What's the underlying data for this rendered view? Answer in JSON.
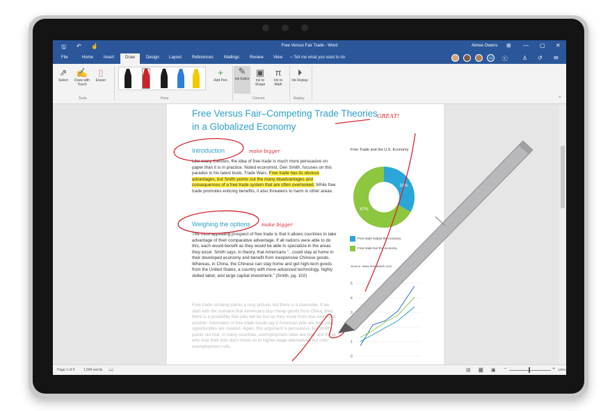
{
  "window": {
    "title": "Free Versus Fair Trade - Word",
    "user": "Aimee Owens",
    "qat_save": "🖫",
    "qat_undo": "↶",
    "qat_touch": "☝",
    "min": "—",
    "max": "▢",
    "close": "✕",
    "ribbon_display": "⊞"
  },
  "tabs": [
    "File",
    "Home",
    "Insert",
    "Draw",
    "Design",
    "Layout",
    "References",
    "Mailings",
    "Review",
    "View"
  ],
  "tell_me": "Tell me what you want to do",
  "collab_count": "+3",
  "ribbon": {
    "select": "Select",
    "draw_touch": "Draw with Touch",
    "eraser": "Eraser",
    "tools_group": "Tools",
    "pens_group": "Pens",
    "add_pen": "Add Pen",
    "ink_editor": "Ink Editor",
    "ink_to_shape": "Ink to Shape",
    "ink_to_math": "Ink to Math",
    "convert_group": "Convert",
    "ink_replay": "Ink Replay",
    "replay_group": "Replay",
    "pen_colors": [
      "#1b1b1b",
      "#c8242a",
      "#1b1b1b",
      "#2e7fd6",
      "#f3c800"
    ]
  },
  "document": {
    "title": "Free Versus Fair–Competing Trade Theories in a Globalized Economy",
    "intro_heading": "Introduction",
    "intro_text_1": "Like many theories, the idea of free trade is much more persuasive on paper than it is in practice. Noted economist, Den Smith, focuses on this paradox in his latest book, Trade Wars. ",
    "intro_highlight": "Free trade has its obvious advantages, but Smith points out the many disadvantages and consequences of a free trade system that are often overlooked.",
    "intro_text_2": " While free trade promotes enticing benefits, it also threatens to harm in other areas.",
    "weigh_heading": "Weighing the options",
    "weigh_text": "The most appealing prospect of free trade is that it allows countries to take advantage of their comparative advantage. If all nations were able to do this, each would benefit as they would be able to specialize in the areas they excel. Smith says, in theory, that Americans “...could stay at home in their developed economy and benefit from inexpensive Chinese goods. Whereas, in China, the Chinese can stay home and get high-tech goods from the United States, a country with more advanced technology, highly skilled labor, and large capital investment.” (Smith, pg. 102)",
    "faded_text": "Free trade certainly paints a rosy picture, but there is a downside. If we start with the scenario that Americans buy cheap goods from China, then there is a possibility that jobs will be lost as they move from one country to another. Advocates of free trade would say if American jobs are lost, new opportunities are created. Again, this argument is persuasive, but Smith points out that, in many countries, unemployment rates are high and those who lose their jobs don't move on to higher-wage alternatives but onto unemployment rolls."
  },
  "chart": {
    "title": "Free Trade and the U.S. Economy",
    "segments": [
      {
        "label": "Free trade helped the economy",
        "value": 33,
        "display": "33%",
        "color": "#2aa7d8"
      },
      {
        "label": "Free trade hurt the economy",
        "value": 67,
        "display": "67%",
        "color": "#8dc63f"
      }
    ],
    "source": "Source: www.trendwatch.com",
    "y_ticks": [
      "5",
      "4",
      "3",
      "2",
      "1",
      "0"
    ]
  },
  "annotations": {
    "great": "GREAT!",
    "make_bigger_1": "make bigger",
    "make_bigger_2": "make bigger"
  },
  "status": {
    "page": "Page 1 of 5",
    "words": "1,584 words",
    "proofing_icon": "📖",
    "zoom": "100%",
    "zoom_minus": "−",
    "zoom_plus": "+"
  }
}
